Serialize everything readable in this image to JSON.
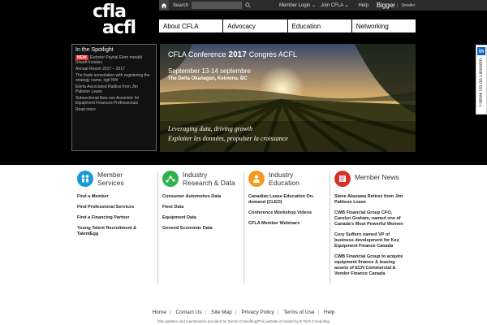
{
  "logo": {
    "line1": "cfla",
    "line2": "acfl"
  },
  "utility": {
    "search_label": "Search",
    "member_login": "Member Login",
    "join": "Join CFLA",
    "help": "Help",
    "bigger": "Bigger",
    "smaller": "Smaller"
  },
  "nav": {
    "items": [
      {
        "label": "About CFLA"
      },
      {
        "label": "Advocacy"
      },
      {
        "label": "Education"
      },
      {
        "label": "Networking"
      }
    ]
  },
  "spotlight": {
    "title": "In the Spotlight",
    "new_badge": "NEW",
    "items": [
      "Elebster Paytial Elem merald Sheeft Instalas",
      "Annual Resort 2017 – 2017",
      "The frade sonsolation with registering the strategy name, rigit NW",
      "Elerta Associated Radliss from Jim Palleton Lease",
      "Subsectional libra use Assoristic for Equipment Finances Professionals",
      "Read more"
    ]
  },
  "hero": {
    "conf_left": "CFLA Conference",
    "year": "2017",
    "conf_right": "Congrès ACFL",
    "dates": "September 13-14 septembre",
    "venue": "The Delta Okanagan, Kelowna, BC",
    "tag_en": "Leveraging data, driving growth",
    "tag_fr": "Exploiter les données, propulser la croissance"
  },
  "linkedin": {
    "logo": "in",
    "text": "Follow Us on LinkedIn"
  },
  "columns": [
    {
      "title_l1": "Member",
      "title_l2": "Services",
      "icon": "people-icon",
      "color": "#1a9bd7",
      "links": [
        "Find a Member",
        "Find Professional Services",
        "Find a Financing Partner",
        "Young Talent Recruitment & TalentEgg"
      ]
    },
    {
      "title_l1": "Industry",
      "title_l2": "Research & Data",
      "icon": "network-icon",
      "color": "#2db34a",
      "links": [
        "Consumer Automotive Data",
        "Fleet Data",
        "Equipment Data",
        "General Economic Data"
      ]
    },
    {
      "title_l1": "Industry",
      "title_l2": "Education",
      "icon": "person-icon",
      "color": "#f39a1e",
      "links": [
        "Canadian Lease Education On-demand (CLEO)",
        "Conference Workshop Videos",
        "CFLA Member Webinars"
      ]
    },
    {
      "title_l1": "Member News",
      "title_l2": "",
      "icon": "news-icon",
      "color": "#d9302b",
      "links": [
        "Steve Akazawa Retires from Jim Pattison Lease",
        "CWB Financial Group CFO, Carolyn Graham, named one of Canada's Most Powerful Women",
        "Cory Suffern named VP of business development for Key Equipment Finance Canada",
        "CWB Financial Group to acquire equipment finance & leasing assets of ECN Commercial & Vendor Finance Canada"
      ]
    }
  ],
  "footer": {
    "links": [
      "Home",
      "Contact Us",
      "Site Map",
      "Privacy Policy",
      "Terms of Use",
      "Help"
    ],
    "credit_left": "Site updates and maintenance provided by Dunne Consulting",
    "credit_right": "This website is hosted by E-Tech Computing"
  }
}
